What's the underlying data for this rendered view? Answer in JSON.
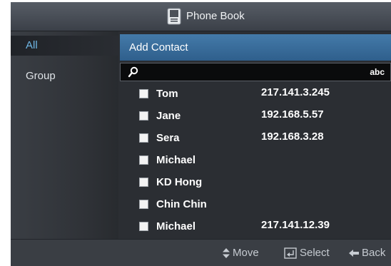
{
  "title": {
    "text": "Phone Book",
    "icon": "phonebook-icon"
  },
  "sidebar": {
    "items": [
      {
        "label": "All",
        "selected": true
      },
      {
        "label": "Group",
        "selected": false
      }
    ]
  },
  "main": {
    "add_contact_label": "Add Contact",
    "search": {
      "value": "",
      "placeholder": "",
      "icon": "search-icon",
      "input_mode": "abc"
    },
    "contacts": [
      {
        "name": "Tom",
        "ip": "217.141.3.245",
        "checked": false
      },
      {
        "name": "Jane",
        "ip": "192.168.5.57",
        "checked": false
      },
      {
        "name": "Sera",
        "ip": "192.168.3.28",
        "checked": false
      },
      {
        "name": "Michael",
        "ip": "",
        "checked": false
      },
      {
        "name": "KD Hong",
        "ip": "",
        "checked": false
      },
      {
        "name": "Chin Chin",
        "ip": "",
        "checked": false
      },
      {
        "name": "Michael",
        "ip": "217.141.12.39",
        "checked": false
      }
    ]
  },
  "footer": {
    "move_label": "Move",
    "select_label": "Select",
    "back_label": "Back",
    "icons": [
      "up-down-arrow-icon",
      "enter-icon",
      "back-arrow-icon"
    ]
  },
  "colors": {
    "accent": "#3a6d9c",
    "selected_text": "#6fb7e6",
    "background": "#2d3035"
  }
}
